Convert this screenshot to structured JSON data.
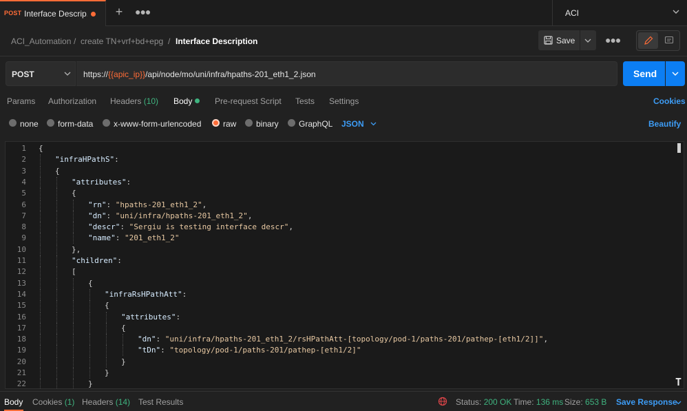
{
  "tabs": {
    "active": {
      "method": "POST",
      "title": "Interface Descrip...",
      "unsaved": true
    },
    "new_tab_icon": "plus-icon",
    "more_icon": "ellipsis-icon"
  },
  "environment": {
    "label": "ACI"
  },
  "breadcrumb": {
    "collection": "ACI_Automation",
    "folder": "create TN+vrf+bd+epg",
    "request": "Interface Description",
    "separator": "/"
  },
  "toolbar": {
    "save_label": "Save"
  },
  "request": {
    "method": "POST",
    "url_prefix": "https://",
    "url_variable": "{{apic_ip}}",
    "url_suffix": "/api/node/mo/uni/infra/hpaths-201_eth1_2.json",
    "send_label": "Send"
  },
  "request_tabs": [
    {
      "label": "Params"
    },
    {
      "label": "Authorization"
    },
    {
      "label": "Headers",
      "count": "(10)"
    },
    {
      "label": "Body",
      "active": true
    },
    {
      "label": "Pre-request Script"
    },
    {
      "label": "Tests"
    },
    {
      "label": "Settings"
    }
  ],
  "cookies_label": "Cookies",
  "body_types": [
    {
      "label": "none"
    },
    {
      "label": "form-data"
    },
    {
      "label": "x-www-form-urlencoded"
    },
    {
      "label": "raw",
      "selected": true
    },
    {
      "label": "binary"
    },
    {
      "label": "GraphQL"
    }
  ],
  "raw_format": "JSON",
  "beautify_label": "Beautify",
  "code_lines": [
    {
      "n": "1",
      "indent": 0,
      "html": "<span class='p'>{</span>"
    },
    {
      "n": "2",
      "indent": 1,
      "html": "<span class='k'>\"infraHPathS\"</span><span class='p'>:</span>"
    },
    {
      "n": "3",
      "indent": 1,
      "html": "<span class='p'>{</span>"
    },
    {
      "n": "4",
      "indent": 2,
      "html": "<span class='k'>\"attributes\"</span><span class='p'>:</span>"
    },
    {
      "n": "5",
      "indent": 2,
      "html": "<span class='p'>{</span>"
    },
    {
      "n": "6",
      "indent": 3,
      "html": "<span class='k'>\"rn\"</span><span class='p'>: </span><span class='s'>\"hpaths-201_eth1_2\"</span><span class='p'>,</span>"
    },
    {
      "n": "7",
      "indent": 3,
      "html": "<span class='k'>\"dn\"</span><span class='p'>: </span><span class='s'>\"uni/infra/hpaths-201_eth1_2\"</span><span class='p'>,</span>"
    },
    {
      "n": "8",
      "indent": 3,
      "html": "<span class='k'>\"descr\"</span><span class='p'>: </span><span class='s'>\"Sergiu is testing interface descr\"</span><span class='p'>,</span>"
    },
    {
      "n": "9",
      "indent": 3,
      "html": "<span class='k'>\"name\"</span><span class='p'>: </span><span class='s'>\"201_eth1_2\"</span>"
    },
    {
      "n": "10",
      "indent": 2,
      "html": "<span class='p'>},</span>"
    },
    {
      "n": "11",
      "indent": 2,
      "html": "<span class='k'>\"children\"</span><span class='p'>:</span>"
    },
    {
      "n": "12",
      "indent": 2,
      "html": "<span class='p'>[</span>"
    },
    {
      "n": "13",
      "indent": 3,
      "html": "<span class='p'>{</span>"
    },
    {
      "n": "14",
      "indent": 4,
      "html": "<span class='k'>\"infraRsHPathAtt\"</span><span class='p'>:</span>"
    },
    {
      "n": "15",
      "indent": 4,
      "html": "<span class='p'>{</span>"
    },
    {
      "n": "16",
      "indent": 5,
      "html": "<span class='k'>\"attributes\"</span><span class='p'>:</span>"
    },
    {
      "n": "17",
      "indent": 5,
      "html": "<span class='p'>{</span>"
    },
    {
      "n": "18",
      "indent": 6,
      "html": "<span class='k'>\"dn\"</span><span class='p'>: </span><span class='s'>\"uni/infra/hpaths-201_eth1_2/rsHPathAtt-[topology/pod-1/paths-201/pathep-[eth1/2]]\"</span><span class='p'>,</span>"
    },
    {
      "n": "19",
      "indent": 6,
      "html": "<span class='k'>\"tDn\"</span><span class='p'>: </span><span class='s'>\"topology/pod-1/paths-201/pathep-[eth1/2]\"</span>"
    },
    {
      "n": "20",
      "indent": 5,
      "html": "<span class='p'>}</span>"
    },
    {
      "n": "21",
      "indent": 4,
      "html": "<span class='p'>}</span>"
    },
    {
      "n": "22",
      "indent": 3,
      "html": "<span class='p'>}</span>"
    }
  ],
  "response_tabs": [
    {
      "label": "Body",
      "active": true
    },
    {
      "label": "Cookies",
      "count": "(1)"
    },
    {
      "label": "Headers",
      "count": "(14)"
    },
    {
      "label": "Test Results"
    }
  ],
  "response_status": {
    "status_label": "Status:",
    "status_value": "200 OK",
    "time_label": "Time:",
    "time_value": "136 ms",
    "size_label": "Size:",
    "size_value": "653 B"
  },
  "save_response_label": "Save Response",
  "colors": {
    "accent": "#ff6c37",
    "primary": "#0c7ef3",
    "success": "#3fb37f",
    "link": "#3d9cf5"
  }
}
